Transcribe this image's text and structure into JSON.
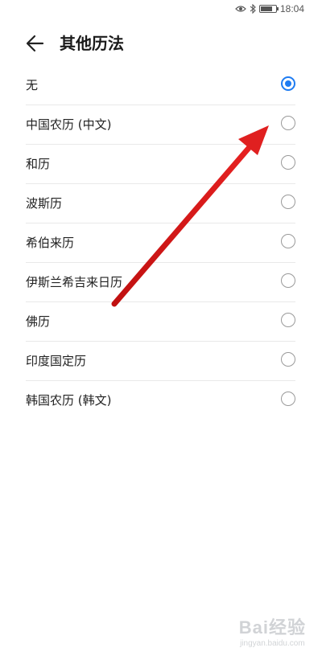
{
  "status_bar": {
    "time": "18:04"
  },
  "header": {
    "title": "其他历法",
    "back_icon": "arrow-left-icon"
  },
  "options": [
    {
      "label": "无",
      "selected": true
    },
    {
      "label": "中国农历 (中文)",
      "selected": false
    },
    {
      "label": "和历",
      "selected": false
    },
    {
      "label": "波斯历",
      "selected": false
    },
    {
      "label": "希伯来历",
      "selected": false
    },
    {
      "label": "伊斯兰希吉来日历",
      "selected": false
    },
    {
      "label": "佛历",
      "selected": false
    },
    {
      "label": "印度国定历",
      "selected": false
    },
    {
      "label": "韩国农历 (韩文)",
      "selected": false
    }
  ],
  "colors": {
    "accent": "#1e7cf2",
    "annotation_arrow": "#e02020"
  },
  "watermark": {
    "logo": "Bai经验",
    "url": "jingyan.baidu.com"
  }
}
